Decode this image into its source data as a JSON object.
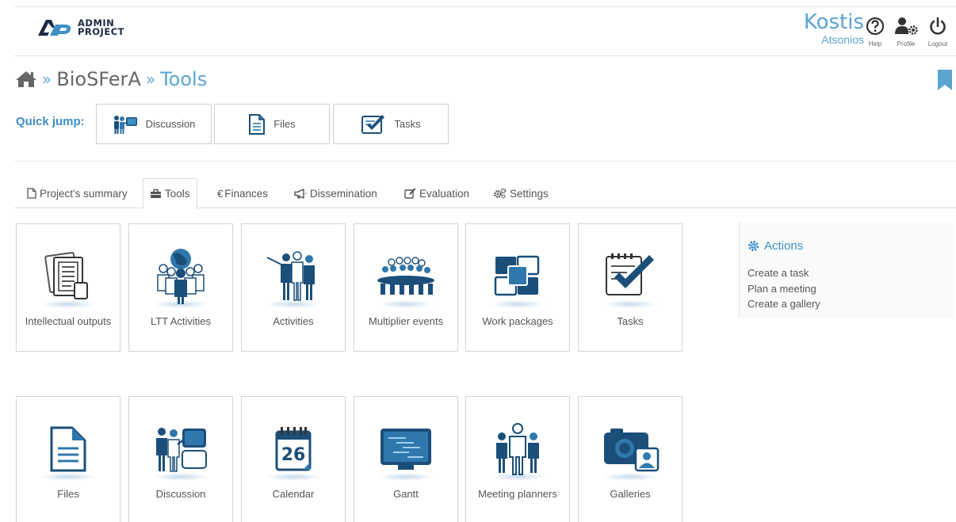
{
  "header": {
    "logo_line1": "ADMIN",
    "logo_line2": "PROJECT",
    "user_first": "Kostis",
    "user_last": "Atsonios",
    "help_label": "Help",
    "profile_label": "Profile",
    "logout_label": "Logout"
  },
  "breadcrumb": {
    "sep1": "»",
    "project": "BioSFerA",
    "sep2": "»",
    "current": "Tools"
  },
  "quick_jump": {
    "label": "Quick jump:",
    "buttons": [
      {
        "label": "Discussion",
        "icon": "discussion-icon"
      },
      {
        "label": "Files",
        "icon": "file-icon"
      },
      {
        "label": "Tasks",
        "icon": "tasks-icon"
      }
    ]
  },
  "tabs": [
    {
      "label": "Project's summary",
      "icon": "document-icon"
    },
    {
      "label": "Tools",
      "icon": "toolbox-icon",
      "active": true
    },
    {
      "label": "Finances",
      "icon": "euro-icon",
      "symbol": "€"
    },
    {
      "label": "Dissemination",
      "icon": "megaphone-icon"
    },
    {
      "label": "Evaluation",
      "icon": "edit-icon"
    },
    {
      "label": "Settings",
      "icon": "gears-icon"
    }
  ],
  "tools": [
    {
      "label": "Intellectual outputs",
      "icon": "documents-icon"
    },
    {
      "label": "LTT Activities",
      "icon": "globe-people-icon"
    },
    {
      "label": "Activities",
      "icon": "presentation-people-icon"
    },
    {
      "label": "Multiplier events",
      "icon": "meeting-table-icon"
    },
    {
      "label": "Work packages",
      "icon": "packages-icon"
    },
    {
      "label": "Tasks",
      "icon": "tasks-icon"
    },
    {
      "label": "Files",
      "icon": "file-icon"
    },
    {
      "label": "Discussion",
      "icon": "discussion-icon"
    },
    {
      "label": "Calendar",
      "icon": "calendar-icon",
      "day": "26"
    },
    {
      "label": "Gantt",
      "icon": "gantt-icon"
    },
    {
      "label": "Meeting planners",
      "icon": "meeting-planner-icon"
    },
    {
      "label": "Galleries",
      "icon": "gallery-icon"
    }
  ],
  "actions": {
    "title": "Actions",
    "items": [
      "Create a task",
      "Plan a meeting",
      "Create a gallery"
    ]
  },
  "colors": {
    "accent": "#5ba4d1",
    "icon_dark": "#1b4f7a",
    "icon_mid": "#2f78ad"
  }
}
